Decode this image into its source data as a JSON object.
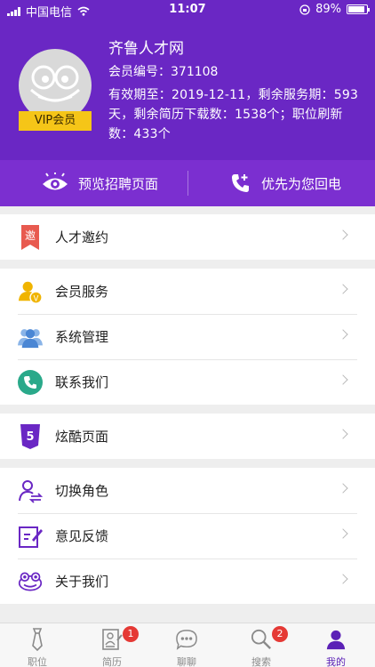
{
  "status_bar": {
    "carrier": "中国电信",
    "time": "11:07",
    "battery": "89%",
    "battery_level": 0.89
  },
  "profile": {
    "company": "齐鲁人才网",
    "member_no": "会员编号：371108",
    "validity": "有效期至：2019-12-11，剩余服务期：593天，剩余简历下载数：1538个；职位刷新数：433个",
    "badge": "VIP会员"
  },
  "actions": {
    "preview": "预览招聘页面",
    "callback": "优先为您回电"
  },
  "menu": {
    "group1": [
      {
        "label": "人才邀约",
        "icon": "invite-icon"
      }
    ],
    "group2": [
      {
        "label": "会员服务",
        "icon": "vip-member-icon"
      },
      {
        "label": "系统管理",
        "icon": "users-icon"
      },
      {
        "label": "联系我们",
        "icon": "phone-icon"
      }
    ],
    "group3": [
      {
        "label": "炫酷页面",
        "icon": "html5-icon"
      }
    ],
    "group4": [
      {
        "label": "切换角色",
        "icon": "switch-role-icon"
      },
      {
        "label": "意见反馈",
        "icon": "feedback-icon"
      },
      {
        "label": "关于我们",
        "icon": "frog-logo-icon"
      }
    ]
  },
  "tabs": [
    {
      "label": "职位",
      "icon": "tie-icon",
      "badge": ""
    },
    {
      "label": "简历",
      "icon": "resume-icon",
      "badge": "1"
    },
    {
      "label": "聊聊",
      "icon": "chat-icon",
      "badge": ""
    },
    {
      "label": "搜索",
      "icon": "search-icon",
      "badge": "2"
    },
    {
      "label": "我的",
      "icon": "person-icon",
      "badge": ""
    }
  ],
  "colors": {
    "header": "#6a27c4",
    "action_bar": "#7b2fd0",
    "vip_badge": "#f5c518",
    "active_tab": "#5b21b6",
    "badge": "#e53935"
  }
}
